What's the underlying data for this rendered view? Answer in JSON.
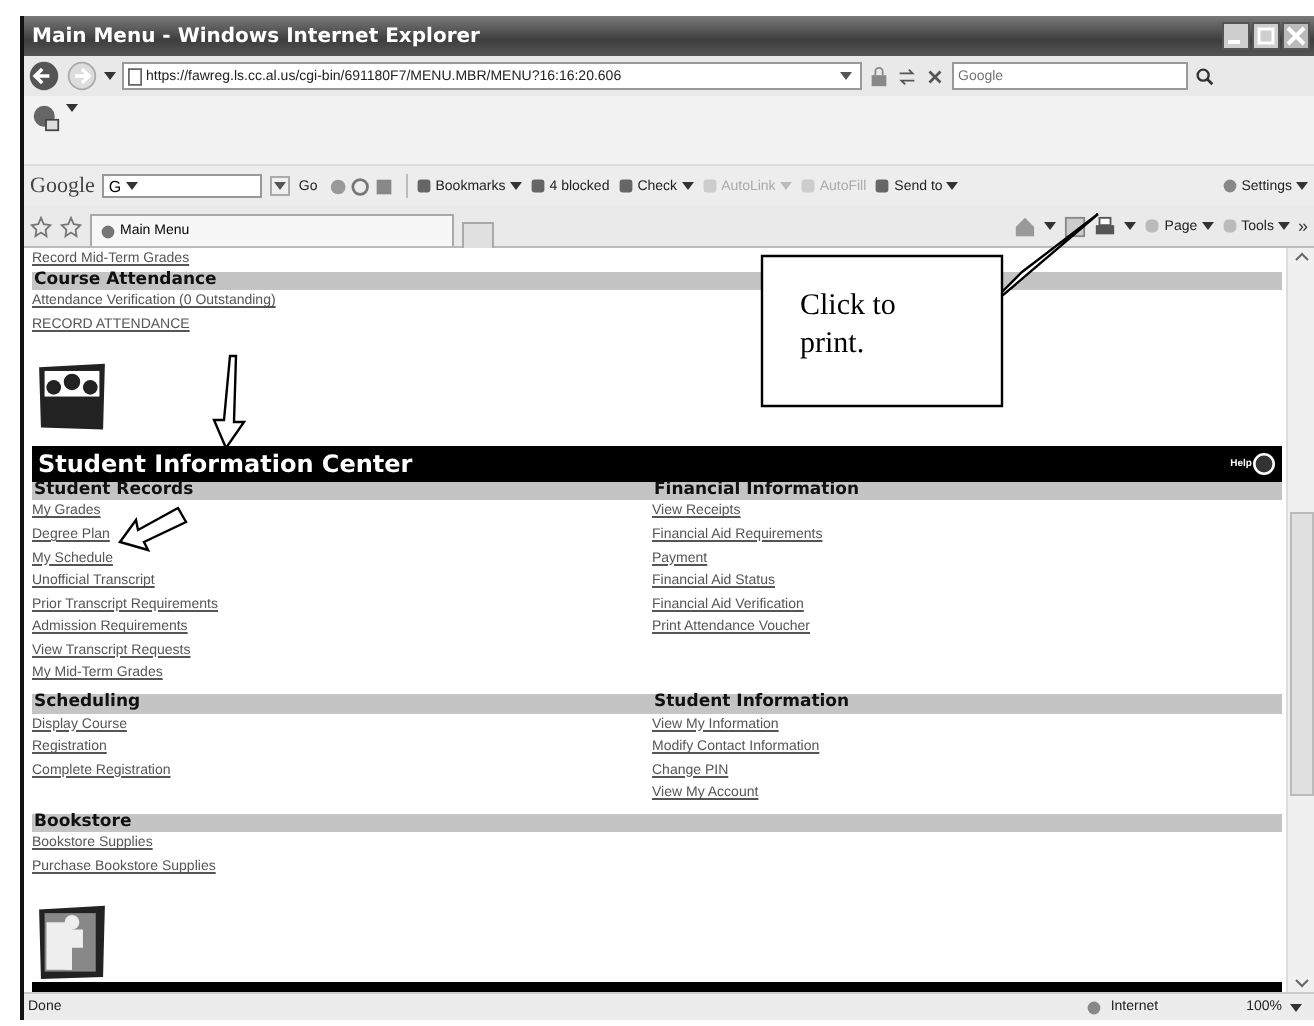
{
  "window": {
    "title": "Main Menu - Windows Internet Explorer"
  },
  "address_bar": {
    "url": "https://fawreg.ls.cc.al.us/cgi-bin/691180F7/MENU.MBR/MENU?16:16:20.606",
    "search_placeholder": "Google"
  },
  "google_toolbar": {
    "label": "Google",
    "search_value": "G",
    "go": "Go",
    "items": [
      {
        "label": "Bookmarks",
        "menu": true,
        "disabled": false
      },
      {
        "label": "4 blocked",
        "menu": false,
        "disabled": false
      },
      {
        "label": "Check",
        "menu": true,
        "disabled": false
      },
      {
        "label": "AutoLink",
        "menu": true,
        "disabled": true
      },
      {
        "label": "AutoFill",
        "menu": false,
        "disabled": true
      },
      {
        "label": "Send to",
        "menu": true,
        "disabled": false
      }
    ],
    "settings": "Settings"
  },
  "tab": {
    "title": "Main Menu"
  },
  "command_bar": {
    "items": [
      "Page",
      "Tools"
    ],
    "overflow": "»"
  },
  "page": {
    "top_links": [
      "Record Mid-Term Grades"
    ],
    "attendance": {
      "title": "Course Attendance",
      "links": [
        "Attendance Verification (0 Outstanding)",
        "RECORD ATTENDANCE"
      ]
    },
    "banner": {
      "title": "Student Information Center",
      "help": "Help"
    },
    "rows": [
      {
        "left": {
          "title": "Student Records",
          "links": [
            "My Grades",
            "Degree Plan",
            "My Schedule",
            "Unofficial Transcript",
            "Prior Transcript Requirements",
            "Admission Requirements",
            "View Transcript Requests",
            "My Mid-Term Grades"
          ]
        },
        "right": {
          "title": "Financial Information",
          "links": [
            "View Receipts",
            "Financial Aid Requirements",
            "Payment",
            "Financial Aid Status",
            "Financial Aid Verification",
            "Print Attendance Voucher"
          ]
        }
      },
      {
        "left": {
          "title": "Scheduling",
          "links": [
            "Display Course",
            "Registration",
            "Complete Registration"
          ]
        },
        "right": {
          "title": "Student Information",
          "links": [
            "View My Information",
            "Modify Contact Information",
            "Change PIN",
            "View My Account"
          ]
        }
      },
      {
        "left": {
          "title": "Bookstore",
          "links": [
            "Bookstore Supplies",
            "Purchase Bookstore Supplies"
          ]
        }
      }
    ]
  },
  "callout": {
    "text": "Click to print."
  },
  "status_bar": {
    "status": "Done",
    "zone": "Internet",
    "zoom": "100%"
  }
}
